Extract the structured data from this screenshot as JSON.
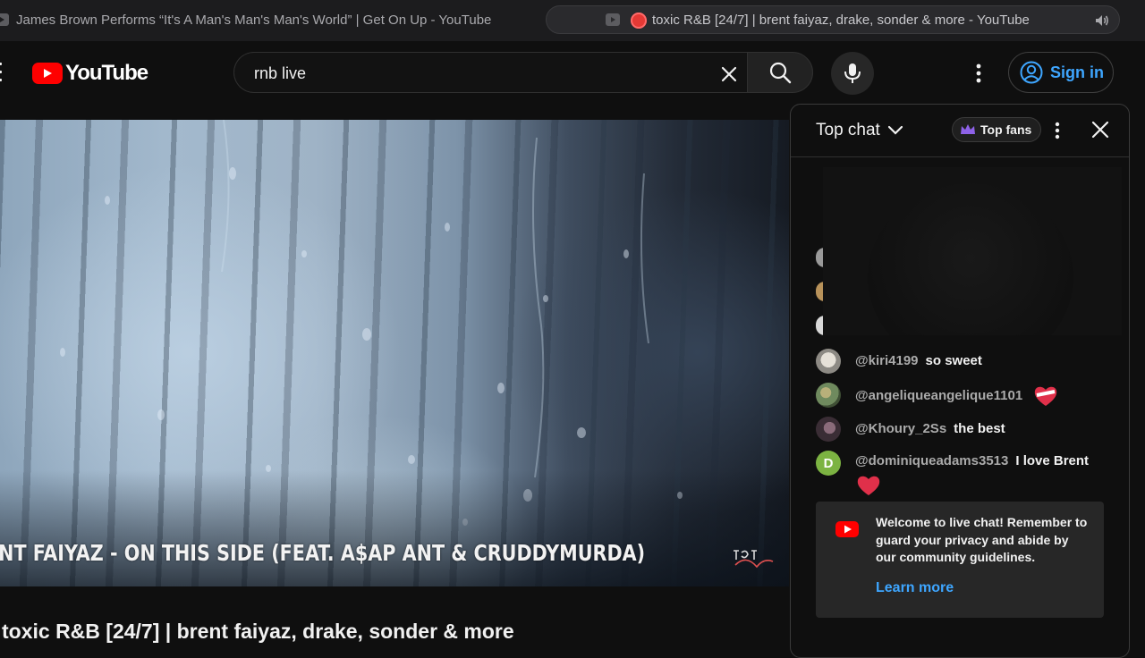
{
  "browser": {
    "tabs": [
      {
        "title": "James Brown Performs “It's A Man's Man's Man's World” | Get On Up - YouTube",
        "active": false
      },
      {
        "title": "toxic R&B [24/7] | brent faiyaz, drake, sonder & more - YouTube",
        "active": true,
        "recording": true,
        "audio": true
      }
    ]
  },
  "masthead": {
    "logo_text": "YouTube",
    "search_value": "rnb live",
    "search_placeholder": "Search",
    "signin_label": "Sign in"
  },
  "video": {
    "overlay_title": "ENT FAIYAZ - ON THIS SIDE (FEAT. A$AP ANT & CRUDDYMURDA)",
    "title": "toxic R&B [24/7] | brent faiyaz, drake, sonder & more"
  },
  "chat": {
    "mode_label": "Top chat",
    "top_fans_label": "Top fans",
    "messages": [
      {
        "author": "@kiri4199",
        "text": "so sweet",
        "avatar_color": "#c9c2b6"
      },
      {
        "author": "@angeliqueangelique1101",
        "text": "",
        "emoji": "heart-emoji",
        "avatar_color": "#6f8a5e"
      },
      {
        "author": "@Khoury_2Ss",
        "text": "the best",
        "avatar_color": "#5a4a55"
      },
      {
        "author": "@dominiqueadams3513",
        "text": "I love Brent",
        "emoji": "heart-emoji",
        "avatar_letter": "D",
        "avatar_color": "#7cb342"
      }
    ],
    "welcome": {
      "text": "Welcome to live chat! Remember to guard your privacy and abide by our community guidelines.",
      "link": "Learn more"
    }
  },
  "colors": {
    "accent": "#3ea6ff",
    "brand": "#ff0000",
    "background": "#0f0f0f"
  }
}
